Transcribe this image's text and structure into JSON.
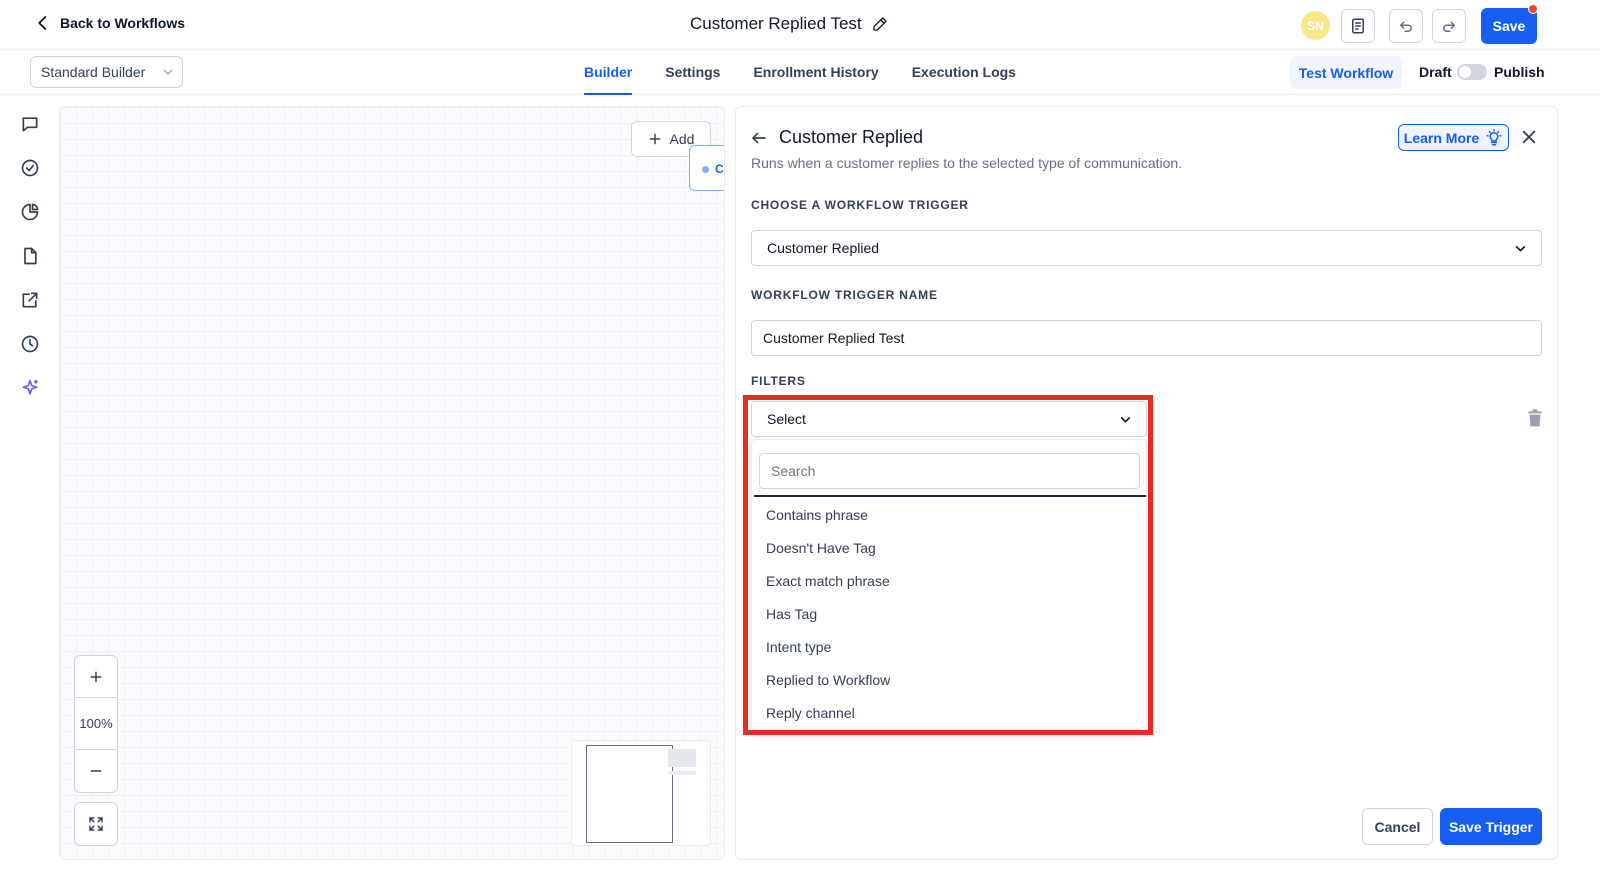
{
  "header": {
    "back_label": "Back to Workflows",
    "workflow_title": "Customer Replied Test",
    "avatar_initials": "SN",
    "save_label": "Save"
  },
  "subnav": {
    "builder_mode": "Standard Builder",
    "tabs": [
      {
        "label": "Builder",
        "active": true
      },
      {
        "label": "Settings",
        "active": false
      },
      {
        "label": "Enrollment History",
        "active": false
      },
      {
        "label": "Execution Logs",
        "active": false
      }
    ],
    "test_label": "Test Workflow",
    "draft_label": "Draft",
    "publish_label": "Publish",
    "published": false
  },
  "canvas": {
    "add_label": "Add",
    "node_label": "C",
    "zoom_level": "100%"
  },
  "panel": {
    "title": "Customer Replied",
    "subtitle": "Runs when a customer replies to the selected type of communication.",
    "learn_more_label": "Learn More",
    "trigger_section_label": "CHOOSE A WORKFLOW TRIGGER",
    "trigger_value": "Customer Replied",
    "name_section_label": "WORKFLOW TRIGGER NAME",
    "name_value": "Customer Replied Test",
    "filters_label": "FILTERS",
    "filter_select_value": "Select",
    "filter_search_placeholder": "Search",
    "filter_options": [
      "Contains phrase",
      "Doesn't Have Tag",
      "Exact match phrase",
      "Has Tag",
      "Intent type",
      "Replied to Workflow",
      "Reply channel"
    ],
    "cancel_label": "Cancel",
    "save_trigger_label": "Save Trigger"
  },
  "colors": {
    "primary": "#155eef",
    "highlight": "#ea2b22",
    "avatar": "#fde68a",
    "notification": "#f04438"
  },
  "icons": [
    "chevron-left-icon",
    "pencil-icon",
    "document-icon",
    "undo-icon",
    "redo-icon",
    "chevron-down-icon",
    "chat-icon",
    "check-circle-icon",
    "pie-chart-icon",
    "file-icon",
    "external-link-icon",
    "clock-icon",
    "sparkle-icon",
    "plus-icon",
    "minus-icon",
    "fullscreen-icon",
    "arrow-left-icon",
    "lightbulb-icon",
    "close-icon",
    "trash-icon"
  ]
}
